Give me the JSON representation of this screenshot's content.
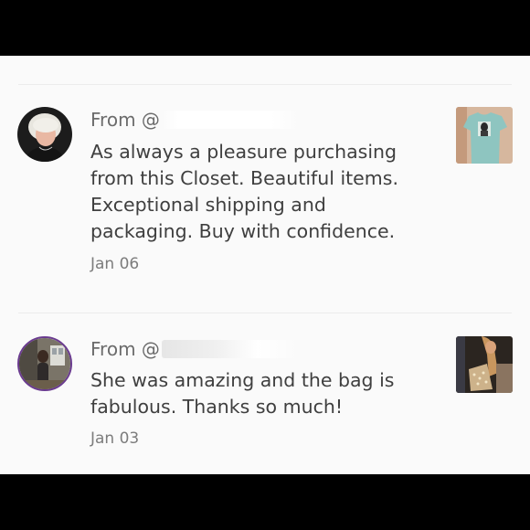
{
  "reviews": [
    {
      "from_prefix": "From @",
      "text": "As always a pleasure purchasing from this Closet. Beautiful items. Exceptional shipping and packaging. Buy with confidence.",
      "date": "Jan 06",
      "avatar_icon": "reviewer-photo",
      "thumb_icon": "tshirt-product-photo"
    },
    {
      "from_prefix": "From @",
      "text": "She was amazing and the bag is fabulous. Thanks so much!",
      "date": "Jan 03",
      "avatar_icon": "reviewer-photo",
      "thumb_icon": "bag-product-photo"
    }
  ],
  "colors": {
    "background": "#fafafa",
    "letterbox": "#000000",
    "body_text": "#3f3f3f",
    "muted_text": "#6b6b6b",
    "divider": "#ececec"
  }
}
